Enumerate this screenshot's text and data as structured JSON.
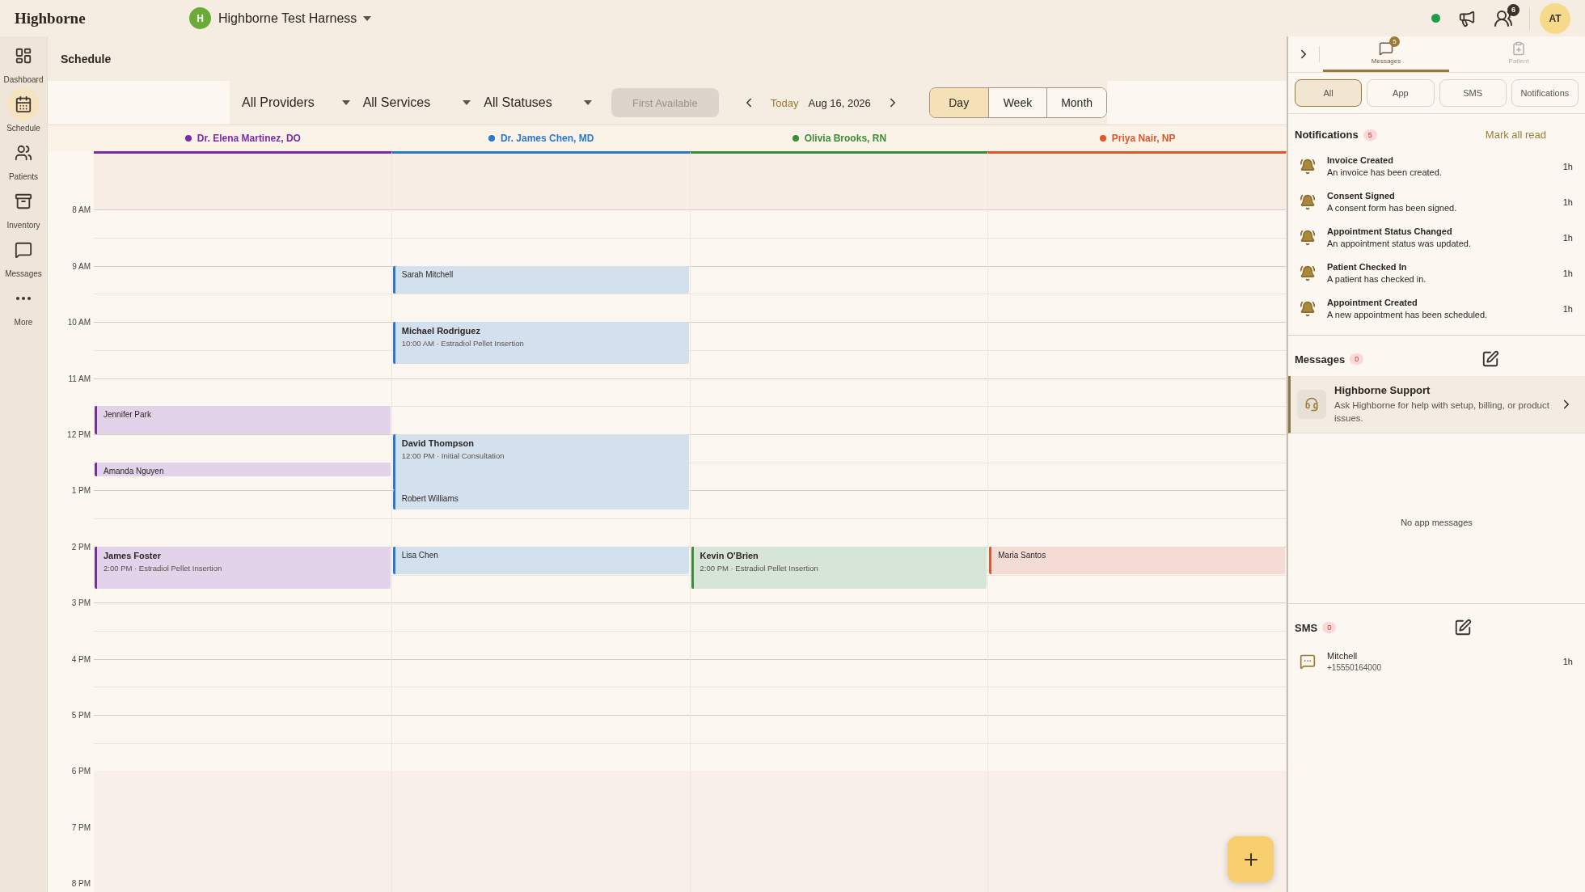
{
  "topbar": {
    "logo": "Highborne",
    "org_initial": "H",
    "org_name": "Highborne Test Harness",
    "people_badge": "6",
    "user_initials": "AT"
  },
  "sidebar": {
    "items": [
      {
        "label": "Dashboard",
        "kind": "dashboard",
        "selected": false
      },
      {
        "label": "Schedule",
        "kind": "calendar",
        "selected": true
      },
      {
        "label": "Patients",
        "kind": "people",
        "selected": false
      },
      {
        "label": "Inventory",
        "kind": "archive",
        "selected": false
      },
      {
        "label": "Messages",
        "kind": "chat",
        "selected": false
      },
      {
        "label": "More",
        "kind": "more",
        "selected": false
      }
    ]
  },
  "page_title": "Schedule",
  "toolbar": {
    "filters": [
      "All Providers",
      "All Services",
      "All Statuses"
    ],
    "first_available": {
      "label": "First Available",
      "disabled": true
    },
    "today": "Today",
    "date": "Aug 16, 2026",
    "views": [
      {
        "label": "Day",
        "selected": true
      },
      {
        "label": "Week",
        "selected": false
      },
      {
        "label": "Month",
        "selected": false
      }
    ]
  },
  "providers": [
    {
      "name": "Dr. Elena Martinez, DO",
      "color": "#7b2aa8"
    },
    {
      "name": "Dr. James Chen, MD",
      "color": "#2a78c8"
    },
    {
      "name": "Olivia Brooks, RN",
      "color": "#3a8d3a"
    },
    {
      "name": "Priya Nair, NP",
      "color": "#e0562a"
    }
  ],
  "hours": [
    {
      "label": "8 AM"
    },
    {
      "label": "9 AM",
      "cells": [
        {
          "kind": "empty"
        },
        {
          "kind": "booked",
          "appointments": [
            {
              "patient": "Sarah Mitchell",
              "kind": "half",
              "half_past": false
            }
          ]
        },
        {
          "kind": "empty"
        },
        {
          "kind": "empty"
        }
      ]
    },
    {
      "label": "10 AM",
      "cells": [
        {
          "kind": "empty"
        },
        {
          "kind": "booked",
          "appointments": [
            {
              "patient": "Michael Rodriguez",
              "detail": "10:00 AM · Estradiol Pellet Insertion",
              "kind": "threequarter",
              "half_past": false
            }
          ]
        },
        {
          "kind": "empty"
        },
        {
          "kind": "empty"
        }
      ]
    },
    {
      "label": "11 AM",
      "cells": [
        {
          "kind": "booked",
          "appointments": [
            {
              "patient": "Jennifer Park",
              "kind": "half",
              "half_past": true
            }
          ]
        },
        {
          "kind": "empty"
        },
        {
          "kind": "empty"
        },
        {
          "kind": "empty"
        }
      ]
    },
    {
      "label": "12 PM",
      "cells": [
        {
          "kind": "booked",
          "appointments": [
            {
              "patient": "Amanda Nguyen",
              "kind": "quarter",
              "half_past": true
            }
          ]
        },
        {
          "kind": "booked",
          "appointments": [
            {
              "patient": "David Thompson",
              "detail": "12:00 PM · Initial Consultation",
              "kind": "hour",
              "half_past": false
            }
          ]
        },
        {
          "kind": "empty"
        },
        {
          "kind": "empty"
        }
      ]
    },
    {
      "label": "1 PM",
      "cells": [
        {
          "kind": "empty"
        },
        {
          "kind": "booked",
          "appointments": [
            {
              "patient": "Robert Williams",
              "kind": "third",
              "half_past": false
            }
          ]
        },
        {
          "kind": "empty"
        },
        {
          "kind": "empty"
        }
      ]
    },
    {
      "label": "2 PM",
      "cells": [
        {
          "kind": "booked",
          "appointments": [
            {
              "patient": "James Foster",
              "detail": "2:00 PM · Estradiol Pellet Insertion",
              "kind": "threequarter",
              "half_past": false
            }
          ]
        },
        {
          "kind": "booked",
          "appointments": [
            {
              "patient": "Lisa Chen",
              "kind": "half",
              "half_past": false
            }
          ]
        },
        {
          "kind": "booked",
          "appointments": [
            {
              "patient": "Kevin O'Brien",
              "detail": "2:00 PM · Estradiol Pellet Insertion",
              "kind": "threequarter",
              "half_past": false
            }
          ]
        },
        {
          "kind": "booked",
          "appointments": [
            {
              "patient": "Maria Santos",
              "kind": "half",
              "half_past": false
            }
          ]
        }
      ]
    },
    {
      "label": "3 PM"
    },
    {
      "label": "4 PM"
    },
    {
      "label": "5 PM"
    },
    {
      "label": "6 PM"
    },
    {
      "label": "7 PM"
    },
    {
      "label": "8 PM"
    }
  ],
  "panel": {
    "tabs": [
      {
        "label": "Messages",
        "badge": "5",
        "kind": "messages",
        "selected": true
      },
      {
        "label": "Patient",
        "kind": "patient",
        "selected": false
      }
    ],
    "filters": [
      {
        "label": "All",
        "selected": true
      },
      {
        "label": "App",
        "selected": false
      },
      {
        "label": "SMS",
        "selected": false
      },
      {
        "label": "Notifications",
        "selected": false
      }
    ],
    "notifications": {
      "title": "Notifications",
      "count": "5",
      "action": "Mark all read",
      "items": [
        {
          "title": "Invoice Created",
          "text": "An invoice has been created.",
          "time": "1h"
        },
        {
          "title": "Consent Signed",
          "text": "A consent form has been signed.",
          "time": "1h"
        },
        {
          "title": "Appointment Status Changed",
          "text": "An appointment status was updated.",
          "time": "1h"
        },
        {
          "title": "Patient Checked In",
          "text": "A patient has checked in.",
          "time": "1h"
        },
        {
          "title": "Appointment Created",
          "text": "A new appointment has been scheduled.",
          "time": "1h"
        }
      ]
    },
    "messages": {
      "title": "Messages",
      "count": "0",
      "support": {
        "title": "Highborne Support",
        "text": "Ask Highborne for help with setup, billing, or product issues."
      },
      "empty": "No app messages"
    },
    "sms": {
      "title": "SMS",
      "count": "0",
      "items": [
        {
          "name": "Mitchell",
          "phone": "+15550164000",
          "time": "1h"
        }
      ]
    }
  }
}
